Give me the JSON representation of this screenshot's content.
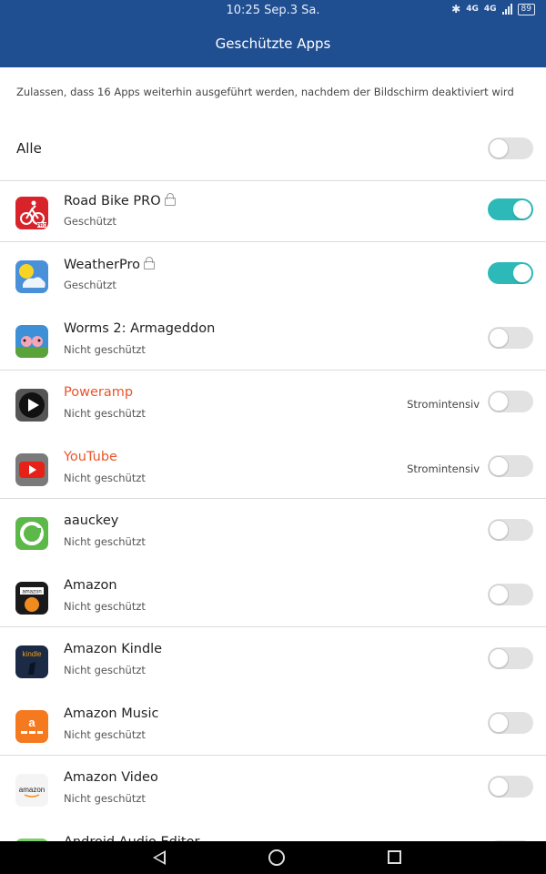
{
  "status_bar": {
    "time": "10:25 Sep.3 Sa.",
    "network_1": "4G",
    "network_2": "4G",
    "battery": "89"
  },
  "header": {
    "title": "Geschützte Apps"
  },
  "description": "Zulassen, dass 16 Apps weiterhin ausgeführt werden, nachdem der Bildschirm deaktiviert wird",
  "all_row": {
    "label": "Alle",
    "enabled": false
  },
  "apps": [
    {
      "name": "Road Bike PRO",
      "status": "Geschützt",
      "locked": true,
      "enabled": true,
      "tag": ""
    },
    {
      "name": "WeatherPro",
      "status": "Geschützt",
      "locked": true,
      "enabled": true,
      "tag": ""
    },
    {
      "name": "Worms 2: Armageddon",
      "status": "Nicht geschützt",
      "locked": false,
      "enabled": false,
      "tag": ""
    },
    {
      "name": "Poweramp",
      "status": "Nicht geschützt",
      "locked": false,
      "enabled": false,
      "tag": "Stromintensiv"
    },
    {
      "name": "YouTube",
      "status": "Nicht geschützt",
      "locked": false,
      "enabled": false,
      "tag": "Stromintensiv"
    },
    {
      "name": "aauckey",
      "status": "Nicht geschützt",
      "locked": false,
      "enabled": false,
      "tag": ""
    },
    {
      "name": "Amazon",
      "status": "Nicht geschützt",
      "locked": false,
      "enabled": false,
      "tag": ""
    },
    {
      "name": "Amazon Kindle",
      "status": "Nicht geschützt",
      "locked": false,
      "enabled": false,
      "tag": ""
    },
    {
      "name": "Amazon Music",
      "status": "Nicht geschützt",
      "locked": false,
      "enabled": false,
      "tag": ""
    },
    {
      "name": "Amazon Video",
      "status": "Nicht geschützt",
      "locked": false,
      "enabled": false,
      "tag": ""
    },
    {
      "name": "Android Audio Editor",
      "status": "",
      "locked": false,
      "enabled": false,
      "tag": ""
    }
  ],
  "colors": {
    "accent": "#2db9b7",
    "header": "#1f4e91",
    "warning_text": "#e8562a"
  },
  "nav": {
    "back": "back-icon",
    "home": "home-icon",
    "recent": "recent-apps-icon"
  }
}
